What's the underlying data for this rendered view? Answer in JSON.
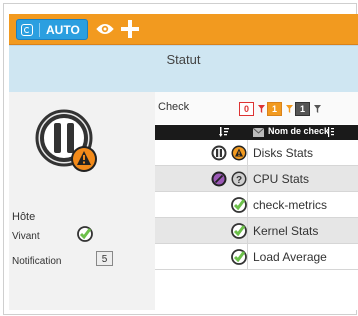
{
  "toolbar": {
    "refresh_mode": "AUTO",
    "icons": [
      "refresh-icon",
      "eye-icon",
      "plus-icon"
    ],
    "colors": {
      "toolbar": "#f29a1f",
      "auto_button": "#2b9fe0"
    }
  },
  "statut": {
    "title": "Statut",
    "color": "#cfe6f2"
  },
  "host": {
    "label": "Hôte",
    "vivant_label": "Vivant",
    "notification_label": "Notification",
    "notification_count": "5",
    "state_icons": [
      "host-pause-icon",
      "warning-badge-icon"
    ]
  },
  "checks": {
    "title": "Check",
    "filters": [
      {
        "value": "0",
        "style": "outline-red"
      },
      {
        "value": "1",
        "style": "orange"
      },
      {
        "value": "1",
        "style": "grey"
      }
    ],
    "columns": {
      "name": "Nom de check"
    },
    "rows": [
      {
        "name": "Disks Stats",
        "icons": [
          "paused-icon",
          "warning-icon"
        ]
      },
      {
        "name": "CPU Stats",
        "icons": [
          "disabled-icon",
          "unknown-icon"
        ]
      },
      {
        "name": "check-metrics",
        "icons": [
          "ok-check-icon"
        ]
      },
      {
        "name": "Kernel Stats",
        "icons": [
          "ok-check-icon"
        ]
      },
      {
        "name": "Load Average",
        "icons": [
          "ok-check-icon"
        ]
      }
    ]
  }
}
